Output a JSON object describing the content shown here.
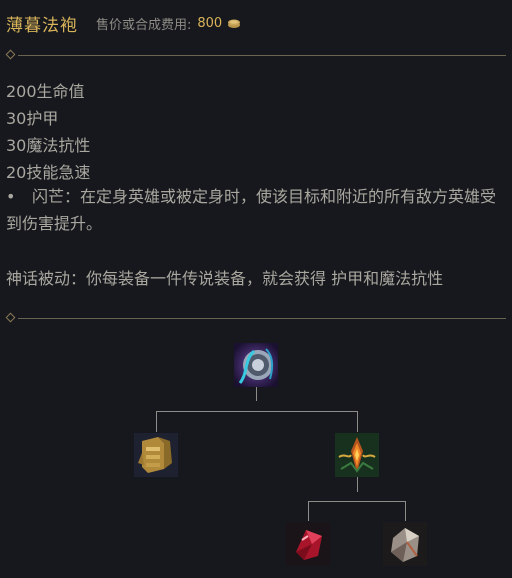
{
  "item": {
    "name": "薄暮法袍",
    "price_label": "售价或合成费用:",
    "price_value": "800"
  },
  "stats": [
    "200生命值",
    "30护甲",
    "30魔法抗性",
    "20技能急速"
  ],
  "passive": {
    "bullet": "•",
    "text": "闪芒：在定身英雄或被定身时，使该目标和附近的所有敌方英雄受到伤害提升。"
  },
  "mythic_passive": "神话被动：你每装备一件传说装备，就会获得 护甲和魔法抗性",
  "build_tree": {
    "root": "shadow-cloak-icon",
    "children": [
      "gold-armor-icon",
      "fire-crest-icon"
    ],
    "grandchildren": [
      "ruby-crystal-icon",
      "cloth-armor-icon"
    ]
  },
  "colors": {
    "gold": "#d9b45a",
    "text": "#a9a79f",
    "background": "#16181d"
  }
}
